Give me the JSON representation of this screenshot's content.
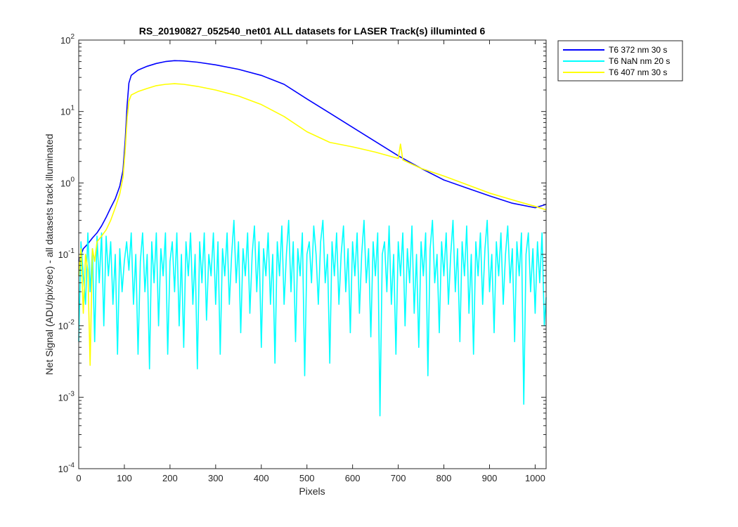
{
  "chart_data": {
    "type": "line",
    "title": "RS_20190827_052540_net01 ALL datasets for LASER  Track(s) illuminted 6",
    "xlabel": "Pixels",
    "ylabel": "Net Signal (ADU/pix/sec) - all datasets track illuminated",
    "xlim": [
      0,
      1024
    ],
    "ylim": [
      0.0001,
      100
    ],
    "yscale": "log",
    "x_ticks": [
      0,
      100,
      200,
      300,
      400,
      500,
      600,
      700,
      800,
      900,
      1000
    ],
    "x_tick_labels": [
      "0",
      "100",
      "200",
      "300",
      "400",
      "500",
      "600",
      "700",
      "800",
      "900",
      "1000"
    ],
    "y_ticks": [
      {
        "value": 0.0001,
        "base": "10",
        "exp": "-4"
      },
      {
        "value": 0.001,
        "base": "10",
        "exp": "-3"
      },
      {
        "value": 0.01,
        "base": "10",
        "exp": "-2"
      },
      {
        "value": 0.1,
        "base": "10",
        "exp": "-1"
      },
      {
        "value": 1,
        "base": "10",
        "exp": "0"
      },
      {
        "value": 10,
        "base": "10",
        "exp": "1"
      },
      {
        "value": 100,
        "base": "10",
        "exp": "2"
      }
    ],
    "grid": false,
    "legend_position": "outside-top-right",
    "series": [
      {
        "name": "T6 372 nm 30 s",
        "color": "#0000ff",
        "points": [
          [
            0,
            0.08
          ],
          [
            10,
            0.12
          ],
          [
            20,
            0.14
          ],
          [
            30,
            0.17
          ],
          [
            40,
            0.2
          ],
          [
            50,
            0.25
          ],
          [
            60,
            0.33
          ],
          [
            70,
            0.45
          ],
          [
            80,
            0.6
          ],
          [
            90,
            0.9
          ],
          [
            97,
            1.5
          ],
          [
            102,
            4
          ],
          [
            106,
            12
          ],
          [
            110,
            25
          ],
          [
            115,
            32
          ],
          [
            130,
            38
          ],
          [
            150,
            43
          ],
          [
            170,
            47
          ],
          [
            190,
            50
          ],
          [
            210,
            51.5
          ],
          [
            230,
            51
          ],
          [
            260,
            49
          ],
          [
            300,
            45
          ],
          [
            350,
            39
          ],
          [
            400,
            32
          ],
          [
            450,
            24
          ],
          [
            500,
            15
          ],
          [
            550,
            9.5
          ],
          [
            600,
            6
          ],
          [
            650,
            3.8
          ],
          [
            700,
            2.4
          ],
          [
            750,
            1.6
          ],
          [
            800,
            1.1
          ],
          [
            850,
            0.85
          ],
          [
            900,
            0.66
          ],
          [
            950,
            0.52
          ],
          [
            1000,
            0.45
          ],
          [
            1024,
            0.5
          ]
        ]
      },
      {
        "name": "T6 NaN nm 20 s",
        "color": "#00ffff",
        "points": [
          [
            0,
            0.006
          ],
          [
            5,
            0.15
          ],
          [
            10,
            0.05
          ],
          [
            15,
            0.02
          ],
          [
            20,
            0.2
          ],
          [
            25,
            0.03
          ],
          [
            30,
            0.12
          ],
          [
            35,
            0.006
          ],
          [
            40,
            0.18
          ],
          [
            45,
            0.04
          ],
          [
            50,
            0.2
          ],
          [
            55,
            0.01
          ],
          [
            60,
            0.18
          ],
          [
            65,
            0.05
          ],
          [
            70,
            0.15
          ],
          [
            75,
            0.02
          ],
          [
            80,
            0.1
          ],
          [
            85,
            0.004
          ],
          [
            90,
            0.12
          ],
          [
            95,
            0.03
          ],
          [
            100,
            0.08
          ],
          [
            105,
            0.15
          ],
          [
            110,
            0.06
          ],
          [
            115,
            0.2
          ],
          [
            120,
            0.02
          ],
          [
            125,
            0.1
          ],
          [
            130,
            0.004
          ],
          [
            135,
            0.08
          ],
          [
            140,
            0.2
          ],
          [
            145,
            0.03
          ],
          [
            150,
            0.1
          ],
          [
            155,
            0.0025
          ],
          [
            160,
            0.15
          ],
          [
            165,
            0.04
          ],
          [
            170,
            0.2
          ],
          [
            175,
            0.01
          ],
          [
            180,
            0.12
          ],
          [
            185,
            0.05
          ],
          [
            190,
            0.2
          ],
          [
            195,
            0.004
          ],
          [
            200,
            0.08
          ],
          [
            205,
            0.15
          ],
          [
            210,
            0.03
          ],
          [
            215,
            0.2
          ],
          [
            220,
            0.01
          ],
          [
            225,
            0.1
          ],
          [
            230,
            0.005
          ],
          [
            235,
            0.15
          ],
          [
            240,
            0.05
          ],
          [
            245,
            0.2
          ],
          [
            250,
            0.02
          ],
          [
            255,
            0.1
          ],
          [
            260,
            0.0025
          ],
          [
            265,
            0.15
          ],
          [
            270,
            0.04
          ],
          [
            275,
            0.2
          ],
          [
            280,
            0.012
          ],
          [
            285,
            0.1
          ],
          [
            290,
            0.05
          ],
          [
            295,
            0.2
          ],
          [
            300,
            0.02
          ],
          [
            305,
            0.15
          ],
          [
            310,
            0.004
          ],
          [
            315,
            0.12
          ],
          [
            320,
            0.05
          ],
          [
            325,
            0.2
          ],
          [
            330,
            0.02
          ],
          [
            335,
            0.1
          ],
          [
            340,
            0.3
          ],
          [
            345,
            0.04
          ],
          [
            350,
            0.15
          ],
          [
            355,
            0.008
          ],
          [
            360,
            0.12
          ],
          [
            365,
            0.05
          ],
          [
            370,
            0.2
          ],
          [
            375,
            0.015
          ],
          [
            380,
            0.1
          ],
          [
            385,
            0.25
          ],
          [
            390,
            0.03
          ],
          [
            395,
            0.15
          ],
          [
            400,
            0.005
          ],
          [
            405,
            0.12
          ],
          [
            410,
            0.05
          ],
          [
            415,
            0.2
          ],
          [
            420,
            0.02
          ],
          [
            425,
            0.1
          ],
          [
            430,
            0.003
          ],
          [
            435,
            0.15
          ],
          [
            440,
            0.05
          ],
          [
            445,
            0.25
          ],
          [
            450,
            0.02
          ],
          [
            455,
            0.1
          ],
          [
            460,
            0.3
          ],
          [
            465,
            0.03
          ],
          [
            470,
            0.15
          ],
          [
            475,
            0.006
          ],
          [
            480,
            0.12
          ],
          [
            485,
            0.05
          ],
          [
            490,
            0.2
          ],
          [
            495,
            0.002
          ],
          [
            500,
            0.1
          ],
          [
            505,
            0.15
          ],
          [
            510,
            0.04
          ],
          [
            515,
            0.25
          ],
          [
            520,
            0.1
          ],
          [
            525,
            0.02
          ],
          [
            530,
            0.15
          ],
          [
            535,
            0.3
          ],
          [
            540,
            0.04
          ],
          [
            545,
            0.1
          ],
          [
            550,
            0.003
          ],
          [
            555,
            0.15
          ],
          [
            560,
            0.05
          ],
          [
            565,
            0.2
          ],
          [
            570,
            0.02
          ],
          [
            575,
            0.1
          ],
          [
            580,
            0.25
          ],
          [
            585,
            0.03
          ],
          [
            590,
            0.12
          ],
          [
            595,
            0.008
          ],
          [
            600,
            0.15
          ],
          [
            605,
            0.05
          ],
          [
            610,
            0.2
          ],
          [
            615,
            0.015
          ],
          [
            620,
            0.1
          ],
          [
            625,
            0.3
          ],
          [
            630,
            0.04
          ],
          [
            635,
            0.12
          ],
          [
            640,
            0.007
          ],
          [
            645,
            0.15
          ],
          [
            650,
            0.05
          ],
          [
            655,
            0.2
          ],
          [
            660,
            0.00055
          ],
          [
            665,
            0.1
          ],
          [
            670,
            0.15
          ],
          [
            675,
            0.03
          ],
          [
            680,
            0.25
          ],
          [
            685,
            0.02
          ],
          [
            690,
            0.1
          ],
          [
            695,
            0.004
          ],
          [
            700,
            0.15
          ],
          [
            705,
            0.05
          ],
          [
            710,
            0.2
          ],
          [
            715,
            0.01
          ],
          [
            720,
            0.12
          ],
          [
            725,
            0.04
          ],
          [
            730,
            0.25
          ],
          [
            735,
            0.015
          ],
          [
            740,
            0.1
          ],
          [
            745,
            0.005
          ],
          [
            750,
            0.15
          ],
          [
            755,
            0.05
          ],
          [
            760,
            0.2
          ],
          [
            765,
            0.002
          ],
          [
            770,
            0.12
          ],
          [
            775,
            0.3
          ],
          [
            780,
            0.04
          ],
          [
            785,
            0.1
          ],
          [
            790,
            0.008
          ],
          [
            795,
            0.15
          ],
          [
            800,
            0.05
          ],
          [
            805,
            0.2
          ],
          [
            810,
            0.02
          ],
          [
            815,
            0.1
          ],
          [
            820,
            0.3
          ],
          [
            825,
            0.03
          ],
          [
            830,
            0.12
          ],
          [
            835,
            0.006
          ],
          [
            840,
            0.15
          ],
          [
            845,
            0.05
          ],
          [
            850,
            0.25
          ],
          [
            855,
            0.015
          ],
          [
            860,
            0.1
          ],
          [
            865,
            0.004
          ],
          [
            870,
            0.15
          ],
          [
            875,
            0.05
          ],
          [
            880,
            0.2
          ],
          [
            885,
            0.02
          ],
          [
            890,
            0.12
          ],
          [
            895,
            0.3
          ],
          [
            900,
            0.03
          ],
          [
            905,
            0.1
          ],
          [
            910,
            0.008
          ],
          [
            915,
            0.15
          ],
          [
            920,
            0.05
          ],
          [
            925,
            0.2
          ],
          [
            930,
            0.02
          ],
          [
            935,
            0.1
          ],
          [
            940,
            0.25
          ],
          [
            945,
            0.04
          ],
          [
            950,
            0.12
          ],
          [
            955,
            0.006
          ],
          [
            960,
            0.15
          ],
          [
            965,
            0.05
          ],
          [
            970,
            0.2
          ],
          [
            975,
            0.0008
          ],
          [
            980,
            0.1
          ],
          [
            985,
            0.2
          ],
          [
            990,
            0.03
          ],
          [
            995,
            0.12
          ],
          [
            1000,
            0.015
          ],
          [
            1005,
            0.15
          ],
          [
            1010,
            0.04
          ],
          [
            1015,
            0.2
          ],
          [
            1020,
            0.01
          ],
          [
            1024,
            0.025
          ]
        ]
      },
      {
        "name": "T6 407 nm 30 s",
        "color": "#ffff00",
        "points": [
          [
            0,
            0.05
          ],
          [
            5,
            0.12
          ],
          [
            10,
            0.015
          ],
          [
            15,
            0.1
          ],
          [
            20,
            0.06
          ],
          [
            25,
            0.0028
          ],
          [
            30,
            0.12
          ],
          [
            35,
            0.08
          ],
          [
            40,
            0.15
          ],
          [
            50,
            0.18
          ],
          [
            60,
            0.22
          ],
          [
            70,
            0.3
          ],
          [
            80,
            0.45
          ],
          [
            90,
            0.7
          ],
          [
            97,
            1.2
          ],
          [
            102,
            3
          ],
          [
            106,
            8
          ],
          [
            110,
            14
          ],
          [
            115,
            17
          ],
          [
            130,
            19
          ],
          [
            150,
            21
          ],
          [
            170,
            23
          ],
          [
            190,
            24
          ],
          [
            210,
            24.5
          ],
          [
            230,
            24
          ],
          [
            260,
            22.5
          ],
          [
            300,
            20
          ],
          [
            350,
            16.5
          ],
          [
            400,
            12.5
          ],
          [
            450,
            8.5
          ],
          [
            500,
            5.2
          ],
          [
            550,
            3.7
          ],
          [
            600,
            3.2
          ],
          [
            650,
            2.7
          ],
          [
            700,
            2.2
          ],
          [
            705,
            3.5
          ],
          [
            710,
            2.1
          ],
          [
            750,
            1.6
          ],
          [
            800,
            1.25
          ],
          [
            850,
            0.95
          ],
          [
            900,
            0.72
          ],
          [
            950,
            0.58
          ],
          [
            1000,
            0.47
          ],
          [
            1024,
            0.42
          ]
        ]
      }
    ]
  }
}
